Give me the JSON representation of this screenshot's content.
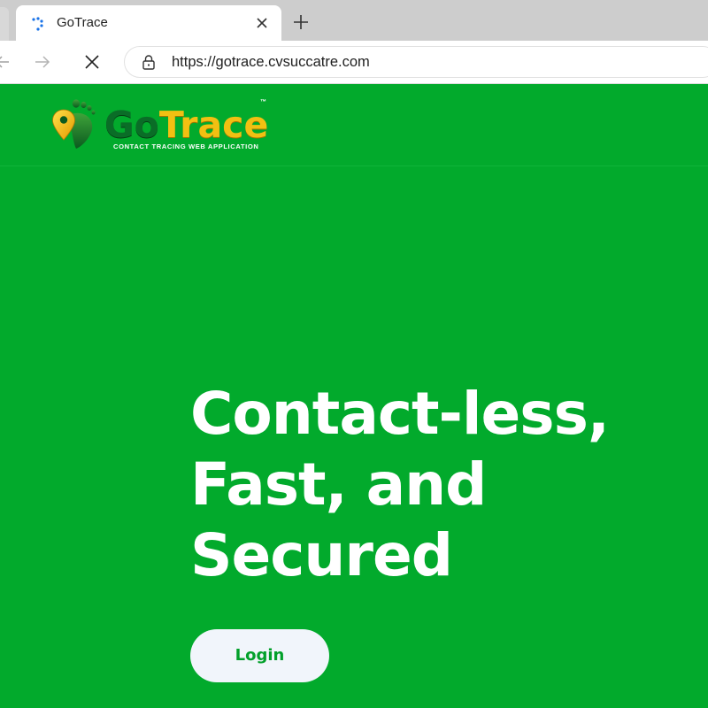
{
  "browser": {
    "tab_title": "GoTrace",
    "url": "https://gotrace.cvsuccatre.com",
    "icons": {
      "favicon": "loading-spinner-icon",
      "tab_close": "close-icon",
      "new_tab": "plus-icon",
      "back": "arrow-left-icon",
      "forward": "arrow-right-icon",
      "stop": "close-icon",
      "lock": "lock-icon"
    }
  },
  "site": {
    "logo": {
      "word_go": "Go",
      "word_trace": "Trace",
      "trademark": "™",
      "tagline": "CONTACT TRACING WEB APPLICATION"
    },
    "hero": {
      "heading_lines": [
        "Contact-less,",
        "Fast, and",
        "Secured"
      ]
    },
    "login_button": "Login"
  },
  "colors": {
    "brand_green": "#02aa2c",
    "logo_dark_green": "#0a6d27",
    "logo_gold": "#f2c012",
    "button_bg": "#f1f5fb",
    "button_text": "#02a02a"
  }
}
